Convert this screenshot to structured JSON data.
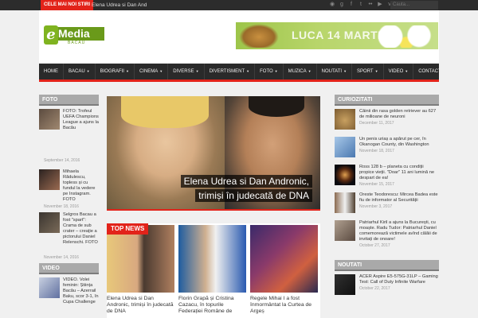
{
  "topbar": {
    "label": "CELE MAI NOI STIRI",
    "ticker": "Elena Udrea si Dan And",
    "social_icons": [
      "rss-icon",
      "google-plus-icon",
      "facebook-icon",
      "twitter-icon",
      "flickr-icon",
      "youtube-icon",
      "vimeo-icon"
    ],
    "search_placeholder": "Cauta..."
  },
  "header": {
    "logo_word": "Media",
    "logo_letter": "e",
    "logo_sub": "BACAU",
    "banner_text": "LUCA 14 MARTIE"
  },
  "nav": {
    "items": [
      {
        "label": "HOME",
        "dropdown": false
      },
      {
        "label": "BACAU",
        "dropdown": true
      },
      {
        "label": "BIOGRAFII",
        "dropdown": true
      },
      {
        "label": "CINEMA",
        "dropdown": true
      },
      {
        "label": "DIVERSE",
        "dropdown": true
      },
      {
        "label": "DIVERTISMENT",
        "dropdown": true
      },
      {
        "label": "FOTO",
        "dropdown": true
      },
      {
        "label": "MUZICA",
        "dropdown": true
      },
      {
        "label": "NOUTATI",
        "dropdown": true
      },
      {
        "label": "SPORT",
        "dropdown": true
      },
      {
        "label": "VIDEO",
        "dropdown": true
      },
      {
        "label": "CONTACT",
        "dropdown": false
      }
    ]
  },
  "left": {
    "foto_head": "FOTO",
    "video_head": "VIDEO",
    "foto_posts": [
      {
        "title": "FOTO: Trofeul UEFA Champions League a ajuns la Bacău",
        "date": "September 14, 2016"
      },
      {
        "title": "Mihaela Rădulescu, topless și cu fundul la vedere pe Instagram. FOTO",
        "date": "November 18, 2016"
      },
      {
        "title": "Selgros Bacau a fost \"spart\": Crama de sub crater – creaţie a pictorului Daniel Relenschi. FOTO",
        "date": "November 14, 2016"
      }
    ],
    "video_posts": [
      {
        "title": "VIDEO. Volei feminin: Știința Bacău – Azerrail Baku, scor 3-1, în Cupa Challenge"
      }
    ]
  },
  "hero": {
    "line1": "Elena Udrea si Dan Andronic,",
    "line2": "trimiși în judecată de DNA"
  },
  "topnews": {
    "head": "TOP NEWS",
    "items": [
      {
        "title": "Elena Udrea si Dan Andronic, trimiși în judecată de DNA"
      },
      {
        "title": "Florin Grapă și Cristina Cazacu, în topurile Federației Române de"
      },
      {
        "title": "Regele Mihai I a fost înmormântat la Curtea de Argeș"
      }
    ]
  },
  "right": {
    "curiozitati_head": "CURIOZITATI",
    "noutati_head": "NOUTATI",
    "curiozitati": [
      {
        "title": "Câinii din rasa golden retriever au 627 de milioane de neuroni",
        "date": "December 11, 2017"
      },
      {
        "title": "Un penis uriaș a apărut pe cer, în Okanogan County, din Washington",
        "date": "November 18, 2017"
      },
      {
        "title": "Ross 128 b – planeta cu condiții propice vieții. \"Doar\" 11 ani lumină ne despart de ea!",
        "date": "November 15, 2017"
      },
      {
        "title": "Oreste Teodorescu: Mircea Badea este fiu de informator al Securității",
        "date": "November 3, 2017"
      },
      {
        "title": "Patriarhul Kiril a ajuns la București, cu moaște. Radu Tudor: Patriarhul Daniel comemorează victimele avînd călăii de invitați de onoare!",
        "date": "October 27, 2017"
      }
    ],
    "noutati": [
      {
        "title": "ACER Aspire E5-575G-31LP – Gaming Test: Call of Duty Infinite Warfare",
        "date": "October 22, 2017"
      }
    ]
  },
  "colors": {
    "accent": "#e2231a",
    "nav_bg": "#2a2a2a",
    "brand_green": "#7fb320",
    "section_head": "#a9a9a9"
  }
}
